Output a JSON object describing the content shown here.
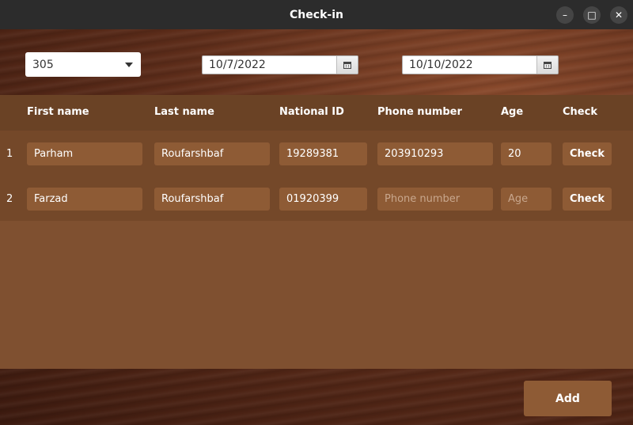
{
  "window": {
    "title": "Check-in",
    "minimize_glyph": "–",
    "maximize_glyph": "□",
    "close_glyph": "✕"
  },
  "controls": {
    "room_select": {
      "value": "305"
    },
    "checkin_date": {
      "value": "10/7/2022"
    },
    "checkout_date": {
      "value": "10/10/2022"
    }
  },
  "table": {
    "headers": [
      "First name",
      "Last name",
      "National ID",
      "Phone number",
      "Age",
      "Check"
    ],
    "rows": [
      {
        "index": "1",
        "first_name": "Parham",
        "last_name": "Roufarshbaf",
        "national_id": "19289381",
        "phone_number": "203910293",
        "age": "20",
        "check_label": "Check"
      },
      {
        "index": "2",
        "first_name": "Farzad",
        "last_name": "Roufarshbaf",
        "national_id": "01920399",
        "phone_placeholder": "Phone number",
        "age_placeholder": "Age",
        "check_label": "Check"
      }
    ]
  },
  "footer": {
    "add_label": "Add"
  },
  "colors": {
    "header_band": "#6a4225",
    "table_body": "#7f5030",
    "field_bg": "#8e5b35",
    "wood_dark": "#3c1a0f"
  },
  "icons": {
    "dropdown": "chevron-down-icon",
    "calendar": "calendar-icon"
  }
}
